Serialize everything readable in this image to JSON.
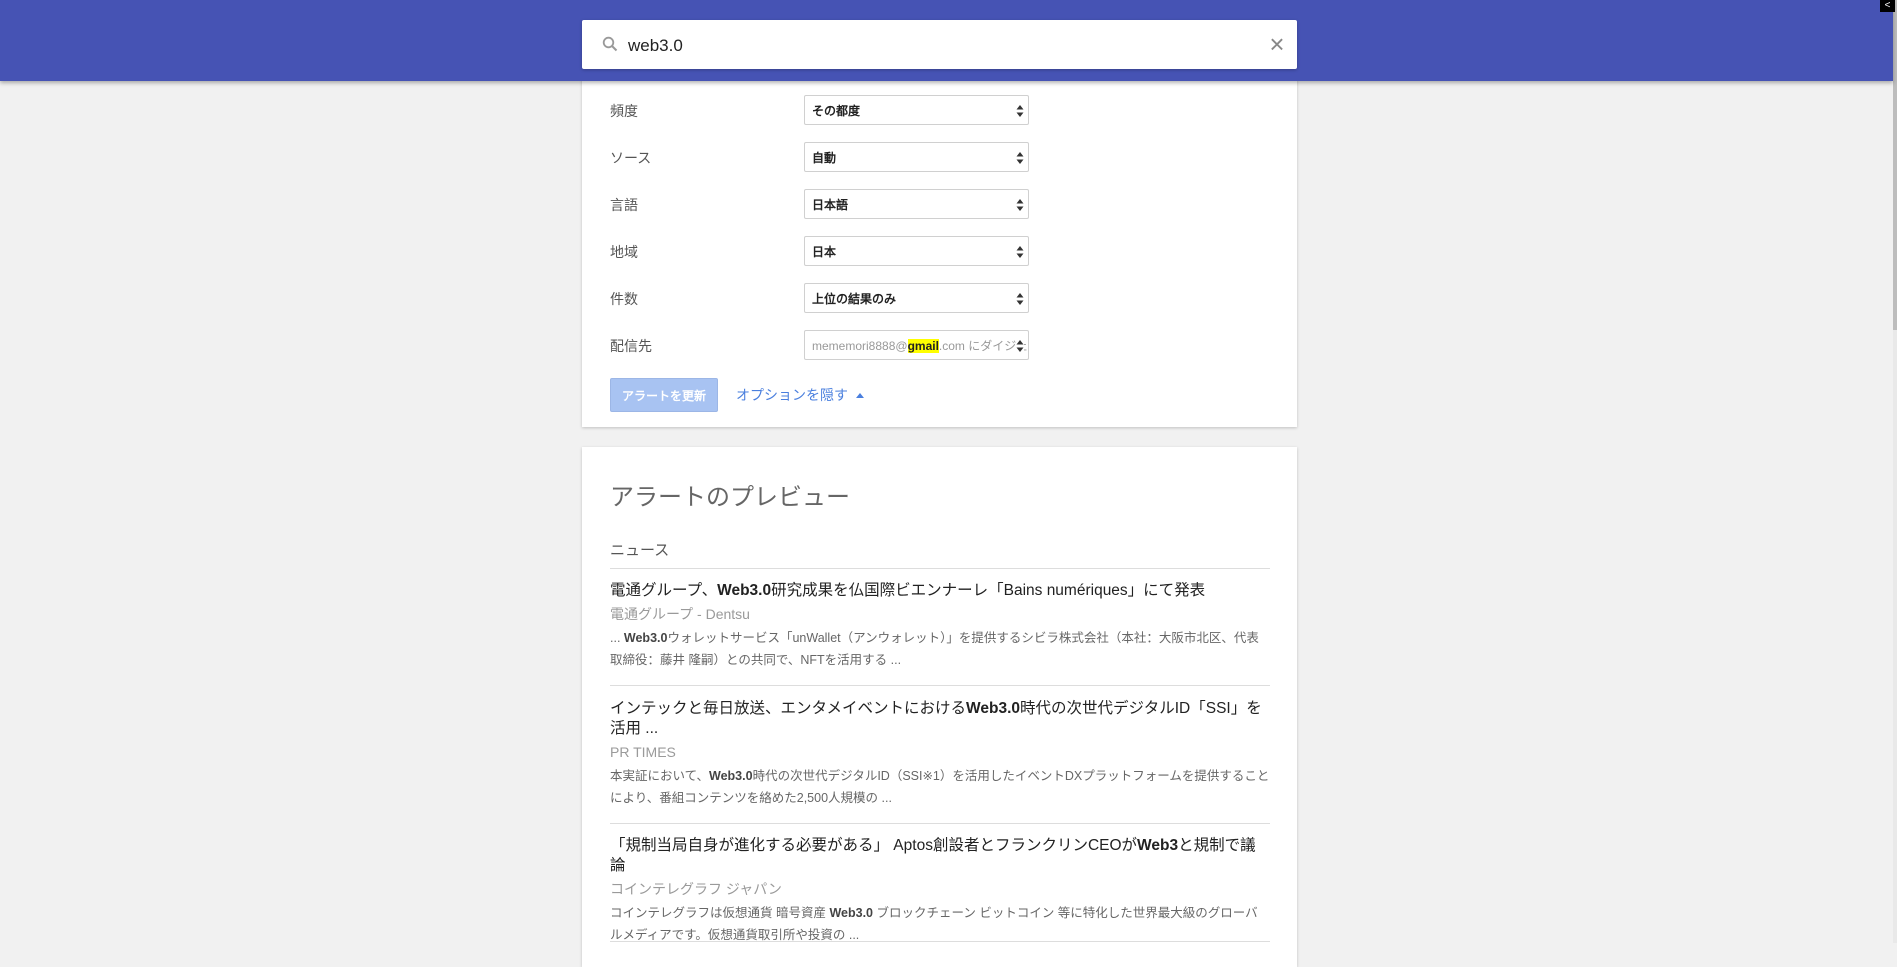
{
  "search": {
    "query": "web3.0"
  },
  "options": {
    "frequency": {
      "label": "頻度",
      "value": "その都度"
    },
    "source": {
      "label": "ソース",
      "value": "自動"
    },
    "language": {
      "label": "言語",
      "value": "日本語"
    },
    "region": {
      "label": "地域",
      "value": "日本"
    },
    "count": {
      "label": "件数",
      "value": "上位の結果のみ"
    },
    "delivery": {
      "label": "配信先",
      "value_prefix": "mememori8888@",
      "value_highlight": "gmail",
      "value_suffix": ".com にダイジェスト"
    },
    "update_button": "アラートを更新",
    "hide_options": "オプションを隠す"
  },
  "preview": {
    "title": "アラートのプレビュー",
    "section": "ニュース",
    "items": [
      {
        "title_pre": "電通グループ、",
        "title_bold": "Web3.0",
        "title_post": "研究成果を仏国際ビエンナーレ「Bains numériques」にて発表",
        "source": "電通グループ - Dentsu",
        "snippet_pre": "... ",
        "snippet_bold": "Web3.0",
        "snippet_post": "ウォレットサービス「unWallet（アンウォレット）」を提供するシビラ株式会社（本社：大阪市北区、代表取締役：藤井 隆嗣）との共同で、NFTを活用する ..."
      },
      {
        "title_pre": "インテックと毎日放送、エンタメイベントにおける",
        "title_bold": "Web3.0",
        "title_post": "時代の次世代デジタルID「SSI」を活用 ...",
        "source": "PR TIMES",
        "snippet_pre": "本実証において、",
        "snippet_bold": "Web3.0",
        "snippet_post": "時代の次世代デジタルID（SSI※1）を活用したイベントDXプラットフォームを提供することにより、番組コンテンツを絡めた2,500人規模の ..."
      },
      {
        "title_pre": "「規制当局自身が進化する必要がある」 Aptos創設者とフランクリンCEOが",
        "title_bold": "Web3",
        "title_post": "と規制で議論",
        "source": "コインテレグラフ ジャパン",
        "snippet_pre": "コインテレグラフは仮想通貨 暗号資産 ",
        "snippet_bold": "Web3.0",
        "snippet_post": " ブロックチェーン ビットコイン 等に特化した世界最大級のグローバルメディアです。仮想通貨取引所や投資の ..."
      }
    ]
  }
}
